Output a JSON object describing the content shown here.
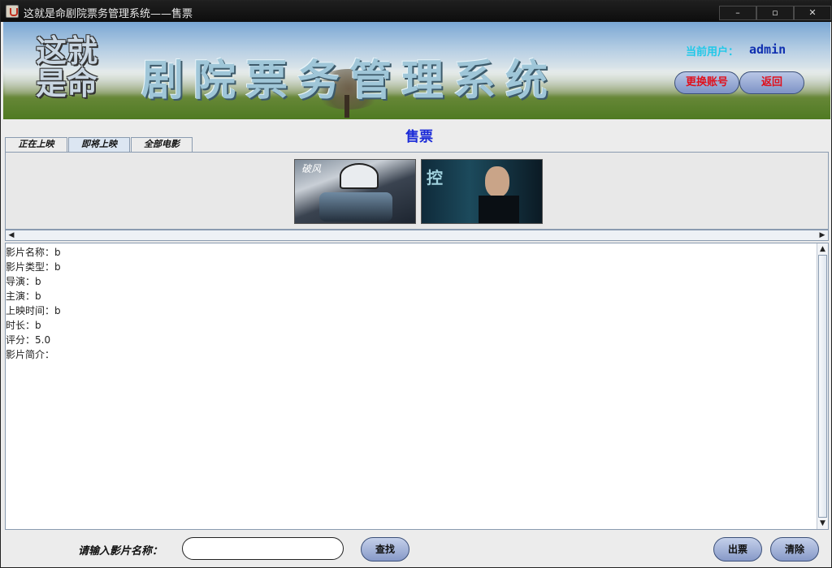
{
  "window": {
    "title": "这就是命剧院票务管理系统——售票",
    "min_glyph": "–",
    "max_glyph": "▫",
    "close_glyph": "✕"
  },
  "banner": {
    "logo_text": "这就是命",
    "title": "剧院票务管理系统",
    "user_label": "当前用户：",
    "user_name": "admin",
    "switch_account": "更换账号",
    "back": "返回"
  },
  "page": {
    "heading": "售票"
  },
  "tabs": [
    {
      "label": "正在上映",
      "active": false
    },
    {
      "label": "即将上映",
      "active": true
    },
    {
      "label": "全部电影",
      "active": false
    }
  ],
  "posters": [
    {
      "name": "poster-cycling",
      "text": "破风"
    },
    {
      "name": "poster-control",
      "text": "控"
    }
  ],
  "movie_info": {
    "lines": [
      "影片名称：b",
      "影片类型：b",
      "导演：b",
      "主演：b",
      "上映时间：b",
      "时长：b",
      "评分：5.0",
      "影片简介："
    ]
  },
  "search": {
    "label": "请输入影片名称：",
    "value": "",
    "search_button": "查找",
    "sell_button": "出票",
    "clear_button": "清除"
  },
  "colors": {
    "heading": "#1a2ad8",
    "user_label": "#20c8e8",
    "user_name": "#1030b0",
    "banner_button_text": "#e0101c"
  }
}
